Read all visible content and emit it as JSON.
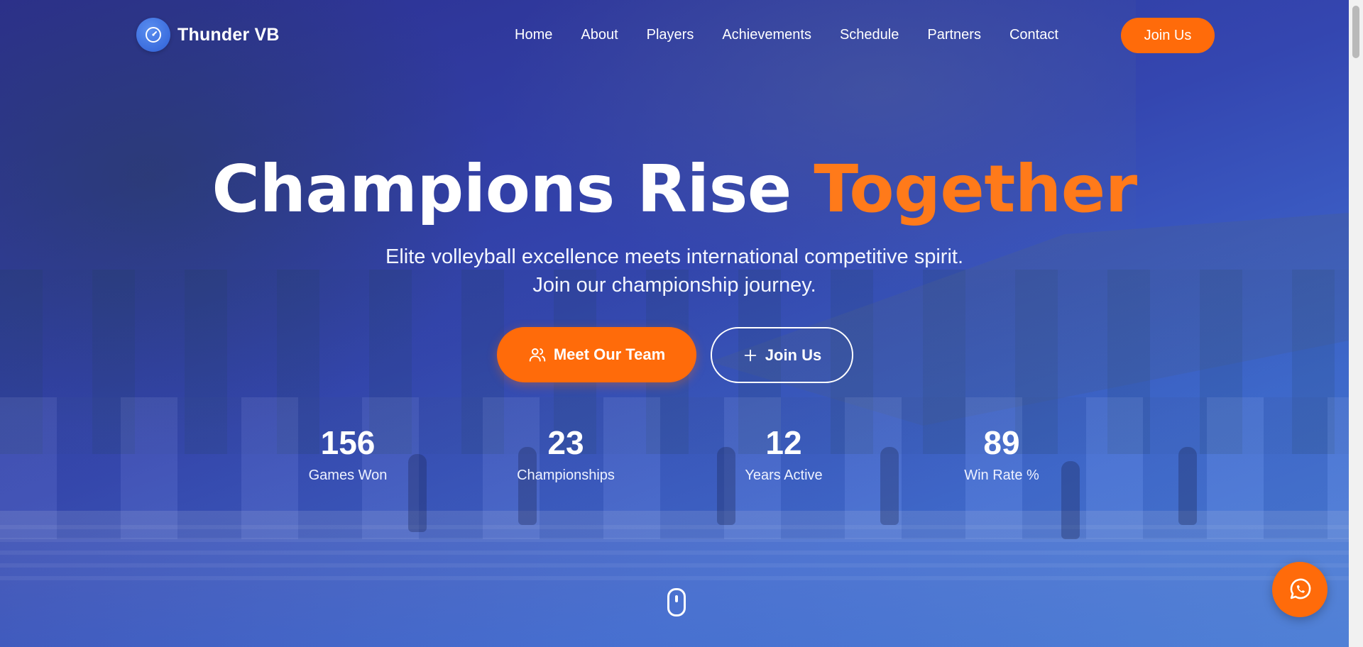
{
  "brand": {
    "name": "Thunder VB",
    "logo_icon": "volleyball-icon"
  },
  "nav": {
    "links": [
      "Home",
      "About",
      "Players",
      "Achievements",
      "Schedule",
      "Partners",
      "Contact"
    ],
    "join_label": "Join Us"
  },
  "hero": {
    "title_main": "Champions Rise ",
    "title_accent": "Together",
    "subtitle_line1": "Elite volleyball excellence meets international competitive spirit.",
    "subtitle_line2": "Join our championship journey.",
    "primary_button": {
      "label": "Meet Our Team",
      "icon": "users-icon"
    },
    "secondary_button": {
      "label": "Join Us",
      "icon": "plus-icon"
    }
  },
  "stats": [
    {
      "value": "156",
      "label": "Games Won"
    },
    {
      "value": "23",
      "label": "Championships"
    },
    {
      "value": "12",
      "label": "Years Active"
    },
    {
      "value": "89",
      "label": "Win Rate %"
    }
  ],
  "fab": {
    "icon": "whatsapp-icon"
  },
  "scroll_indicator_icon": "mouse-icon",
  "colors": {
    "accent": "#ff6b0a",
    "accent_text": "#ff7a1a",
    "hero_overlay_start": "#2c2f8f",
    "hero_overlay_end": "#4a7fd8",
    "text": "#ffffff"
  }
}
